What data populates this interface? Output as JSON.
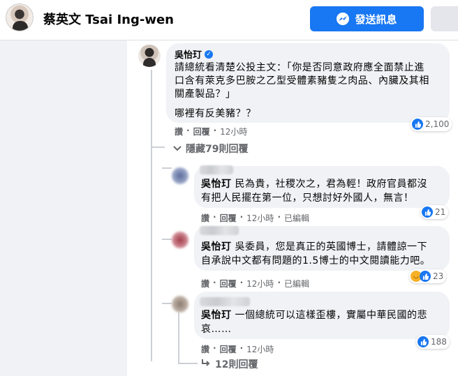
{
  "header": {
    "page_name": "蔡英文 Tsai Ing-wen",
    "send_label": "發送訊息"
  },
  "main_comment": {
    "author": "吳怡玎",
    "text_line1": "請總統看清楚公投主文：「你是否同意政府應全面禁止進",
    "text_line2": "口含有萊克多巴胺之乙型受體素豬隻之肉品、內臟及其相",
    "text_line3": "關產製品？」",
    "text_line4": "哪裡有反美豬？？",
    "action_like": "讚",
    "action_reply": "回覆",
    "time": "12小時",
    "reaction_count": "2,100"
  },
  "hide_replies": "隱藏79則回覆",
  "replies": [
    {
      "mention": "吳怡玎",
      "text_line1": " 民為貴，社稷次之，君為輕！政府官員都沒",
      "text_line2": "有把人民擺在第一位，只想討好外國人，無言！",
      "action_like": "讚",
      "action_reply": "回覆",
      "time": "12小時",
      "edited": "已編輯",
      "reaction_count": "21"
    },
    {
      "mention": "吳怡玎",
      "text_line1": " 吳委員，您是真正的英國博士，請體諒一下",
      "text_line2": "自承說中文都有問題的1.5博士的中文閱讀能力吧。",
      "action_like": "讚",
      "action_reply": "回覆",
      "time": "12小時",
      "edited": "已編輯",
      "reaction_count": "23"
    },
    {
      "mention": "吳怡玎",
      "text_line1": " 一個總統可以這樣歪樓，實屬中華民國的悲",
      "text_line2": "哀……",
      "action_like": "讚",
      "action_reply": "回覆",
      "time": "12小時",
      "reaction_count": "188"
    }
  ],
  "more_replies": "12則回覆",
  "colors": {
    "accent": "#1877f2",
    "bubble": "#f0f2f5",
    "muted_text": "#65676b"
  }
}
